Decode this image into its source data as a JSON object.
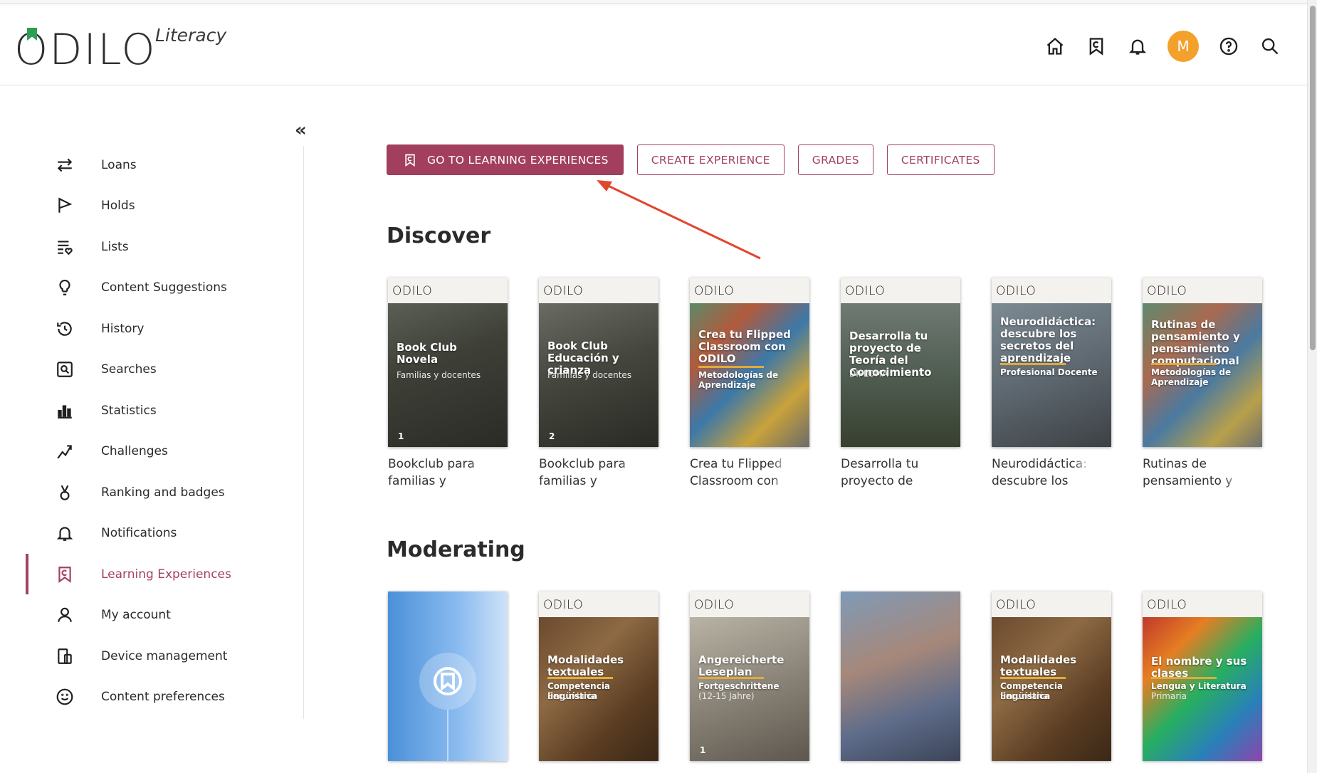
{
  "app": {
    "logo_text": "ODILO",
    "logo_sub": "Literacy",
    "avatar_initial": "M",
    "accent_color": "#a23f5e"
  },
  "header_icons": [
    "home-icon",
    "learning-experiences-icon",
    "bell-icon",
    "avatar",
    "help-icon",
    "search-icon"
  ],
  "sidebar": {
    "collapse_label": "«",
    "items": [
      {
        "label": "Loans",
        "icon": "swap-arrows-icon"
      },
      {
        "label": "Holds",
        "icon": "flag-icon"
      },
      {
        "label": "Lists",
        "icon": "list-heart-icon"
      },
      {
        "label": "Content Suggestions",
        "icon": "lightbulb-icon"
      },
      {
        "label": "History",
        "icon": "history-icon"
      },
      {
        "label": "Searches",
        "icon": "saved-search-icon"
      },
      {
        "label": "Statistics",
        "icon": "bar-chart-icon"
      },
      {
        "label": "Challenges",
        "icon": "challenge-icon"
      },
      {
        "label": "Ranking and badges",
        "icon": "medal-icon"
      },
      {
        "label": "Notifications",
        "icon": "bell-icon"
      },
      {
        "label": "Learning Experiences",
        "icon": "learning-experiences-icon",
        "active": true
      },
      {
        "label": "My account",
        "icon": "user-icon"
      },
      {
        "label": "Device management",
        "icon": "devices-icon"
      },
      {
        "label": "Content preferences",
        "icon": "smiley-icon"
      }
    ]
  },
  "actions": {
    "go_to": "GO TO LEARNING EXPERIENCES",
    "create": "CREATE EXPERIENCE",
    "grades": "GRADES",
    "certificates": "CERTIFICATES"
  },
  "discover": {
    "title": "Discover",
    "cards": [
      {
        "cover_title": "Book Club Novela",
        "cover_sub": "Familias y docentes",
        "cover_num": "1",
        "caption": "Bookclub para familias y docentes"
      },
      {
        "cover_title": "Book Club Educación y crianza",
        "cover_sub": "Familias y docentes",
        "cover_num": "2",
        "caption": "Bookclub para familias y docentes"
      },
      {
        "cover_title": "Crea tu Flipped Classroom con ODILO",
        "cover_cat": "Metodologías de Aprendizaje",
        "caption": "Crea tu Flipped Classroom con ODILO"
      },
      {
        "cover_title": "Desarrolla tu proyecto de Teoría del Conocimiento",
        "cover_sub": "DIPLOMA",
        "caption": "Desarrolla tu proyecto de Teoría del Conocimiento"
      },
      {
        "cover_title": "Neurodidáctica: descubre los secretos del aprendizaje",
        "cover_cat": "Profesional Docente",
        "caption": "Neurodidáctica: descubre los secretos del aprendizaje"
      },
      {
        "cover_title": "Rutinas de pensamiento y pensamiento computacional",
        "cover_cat": "Metodologías de Aprendizaje",
        "caption": "Rutinas de pensamiento y pensamiento computacional"
      }
    ]
  },
  "moderating": {
    "title": "Moderating",
    "cards": [
      {
        "cover_title": "",
        "caption": ""
      },
      {
        "cover_title": "Modalidades textuales",
        "cover_cat": "Competencia lingüística",
        "cover_sub": "Secundaria",
        "caption": ""
      },
      {
        "cover_title": "Angereicherte Leseplan",
        "cover_cat": "Fortgeschrittene",
        "cover_sub": "(12-15 Jahre)",
        "cover_num": "1",
        "caption": ""
      },
      {
        "cover_title": "",
        "caption": ""
      },
      {
        "cover_title": "Modalidades textuales",
        "cover_cat": "Competencia lingüística",
        "cover_sub": "Secundaria",
        "caption": ""
      },
      {
        "cover_title": "El nombre y sus clases",
        "cover_cat": "Lengua y Literatura",
        "cover_sub": "Primaria",
        "caption": ""
      }
    ]
  }
}
